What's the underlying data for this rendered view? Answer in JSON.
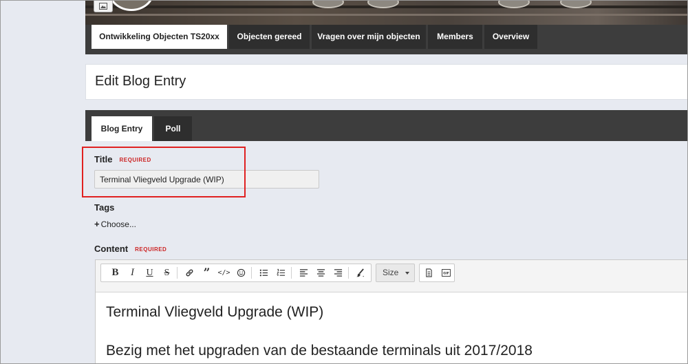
{
  "club_nav": {
    "tabs": [
      {
        "label": "Ontwikkeling Objecten TS20xx",
        "active": true
      },
      {
        "label": "Objecten gereed",
        "active": false
      },
      {
        "label": "Vragen over mijn objecten",
        "active": false
      },
      {
        "label": "Members",
        "active": false
      },
      {
        "label": "Overview",
        "active": false
      }
    ]
  },
  "page": {
    "title": "Edit Blog Entry"
  },
  "form_tabs": [
    {
      "label": "Blog Entry",
      "active": true
    },
    {
      "label": "Poll",
      "active": false
    }
  ],
  "form": {
    "title_label": "Title",
    "required_label": "REQUIRED",
    "title_value": "Terminal Vliegveld Upgrade (WIP)",
    "tags_label": "Tags",
    "tags_choose": "Choose...",
    "content_label": "Content",
    "content_required_label": "REQUIRED"
  },
  "editor": {
    "size_label": "Size",
    "icons": [
      "bold-icon",
      "italic-icon",
      "underline-icon",
      "strikethrough-icon",
      "link-icon",
      "quote-icon",
      "code-icon",
      "emoji-icon",
      "bulleted-list-icon",
      "numbered-list-icon",
      "align-left-icon",
      "align-center-icon",
      "align-right-icon",
      "text-color-icon",
      "source-icon",
      "gif-icon"
    ],
    "content_lines": [
      "Terminal Vliegveld Upgrade (WIP)",
      "Bezig met het upgraden van de bestaande terminals uit 2017/2018"
    ]
  },
  "colors": {
    "accent_red": "#e02020",
    "nav_dark": "#3d3d3d",
    "required_red": "#cc2222"
  }
}
